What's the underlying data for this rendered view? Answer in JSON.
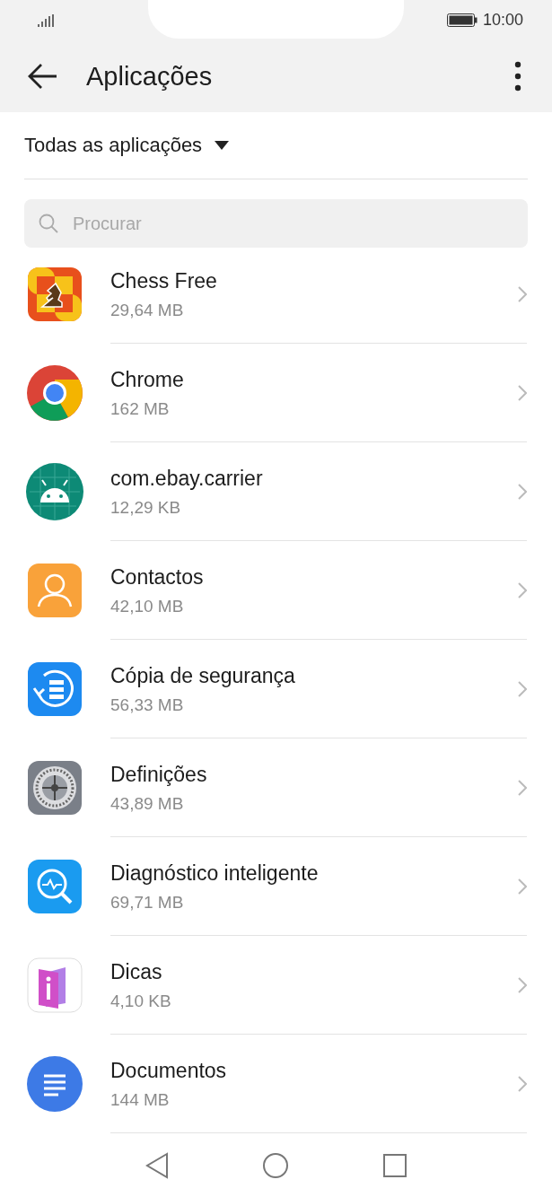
{
  "status_bar": {
    "time": "10:00"
  },
  "header": {
    "title": "Aplicações"
  },
  "filter": {
    "label": "Todas as aplicações"
  },
  "search": {
    "placeholder": "Procurar"
  },
  "apps": [
    {
      "name": "Chess Free",
      "size": "29,64 MB"
    },
    {
      "name": "Chrome",
      "size": "162 MB"
    },
    {
      "name": "com.ebay.carrier",
      "size": "12,29 KB"
    },
    {
      "name": "Contactos",
      "size": "42,10 MB"
    },
    {
      "name": "Cópia de segurança",
      "size": "56,33 MB"
    },
    {
      "name": "Definições",
      "size": "43,89 MB"
    },
    {
      "name": "Diagnóstico inteligente",
      "size": "69,71 MB"
    },
    {
      "name": "Dicas",
      "size": "4,10 KB"
    },
    {
      "name": "Documentos",
      "size": "144 MB"
    }
  ]
}
